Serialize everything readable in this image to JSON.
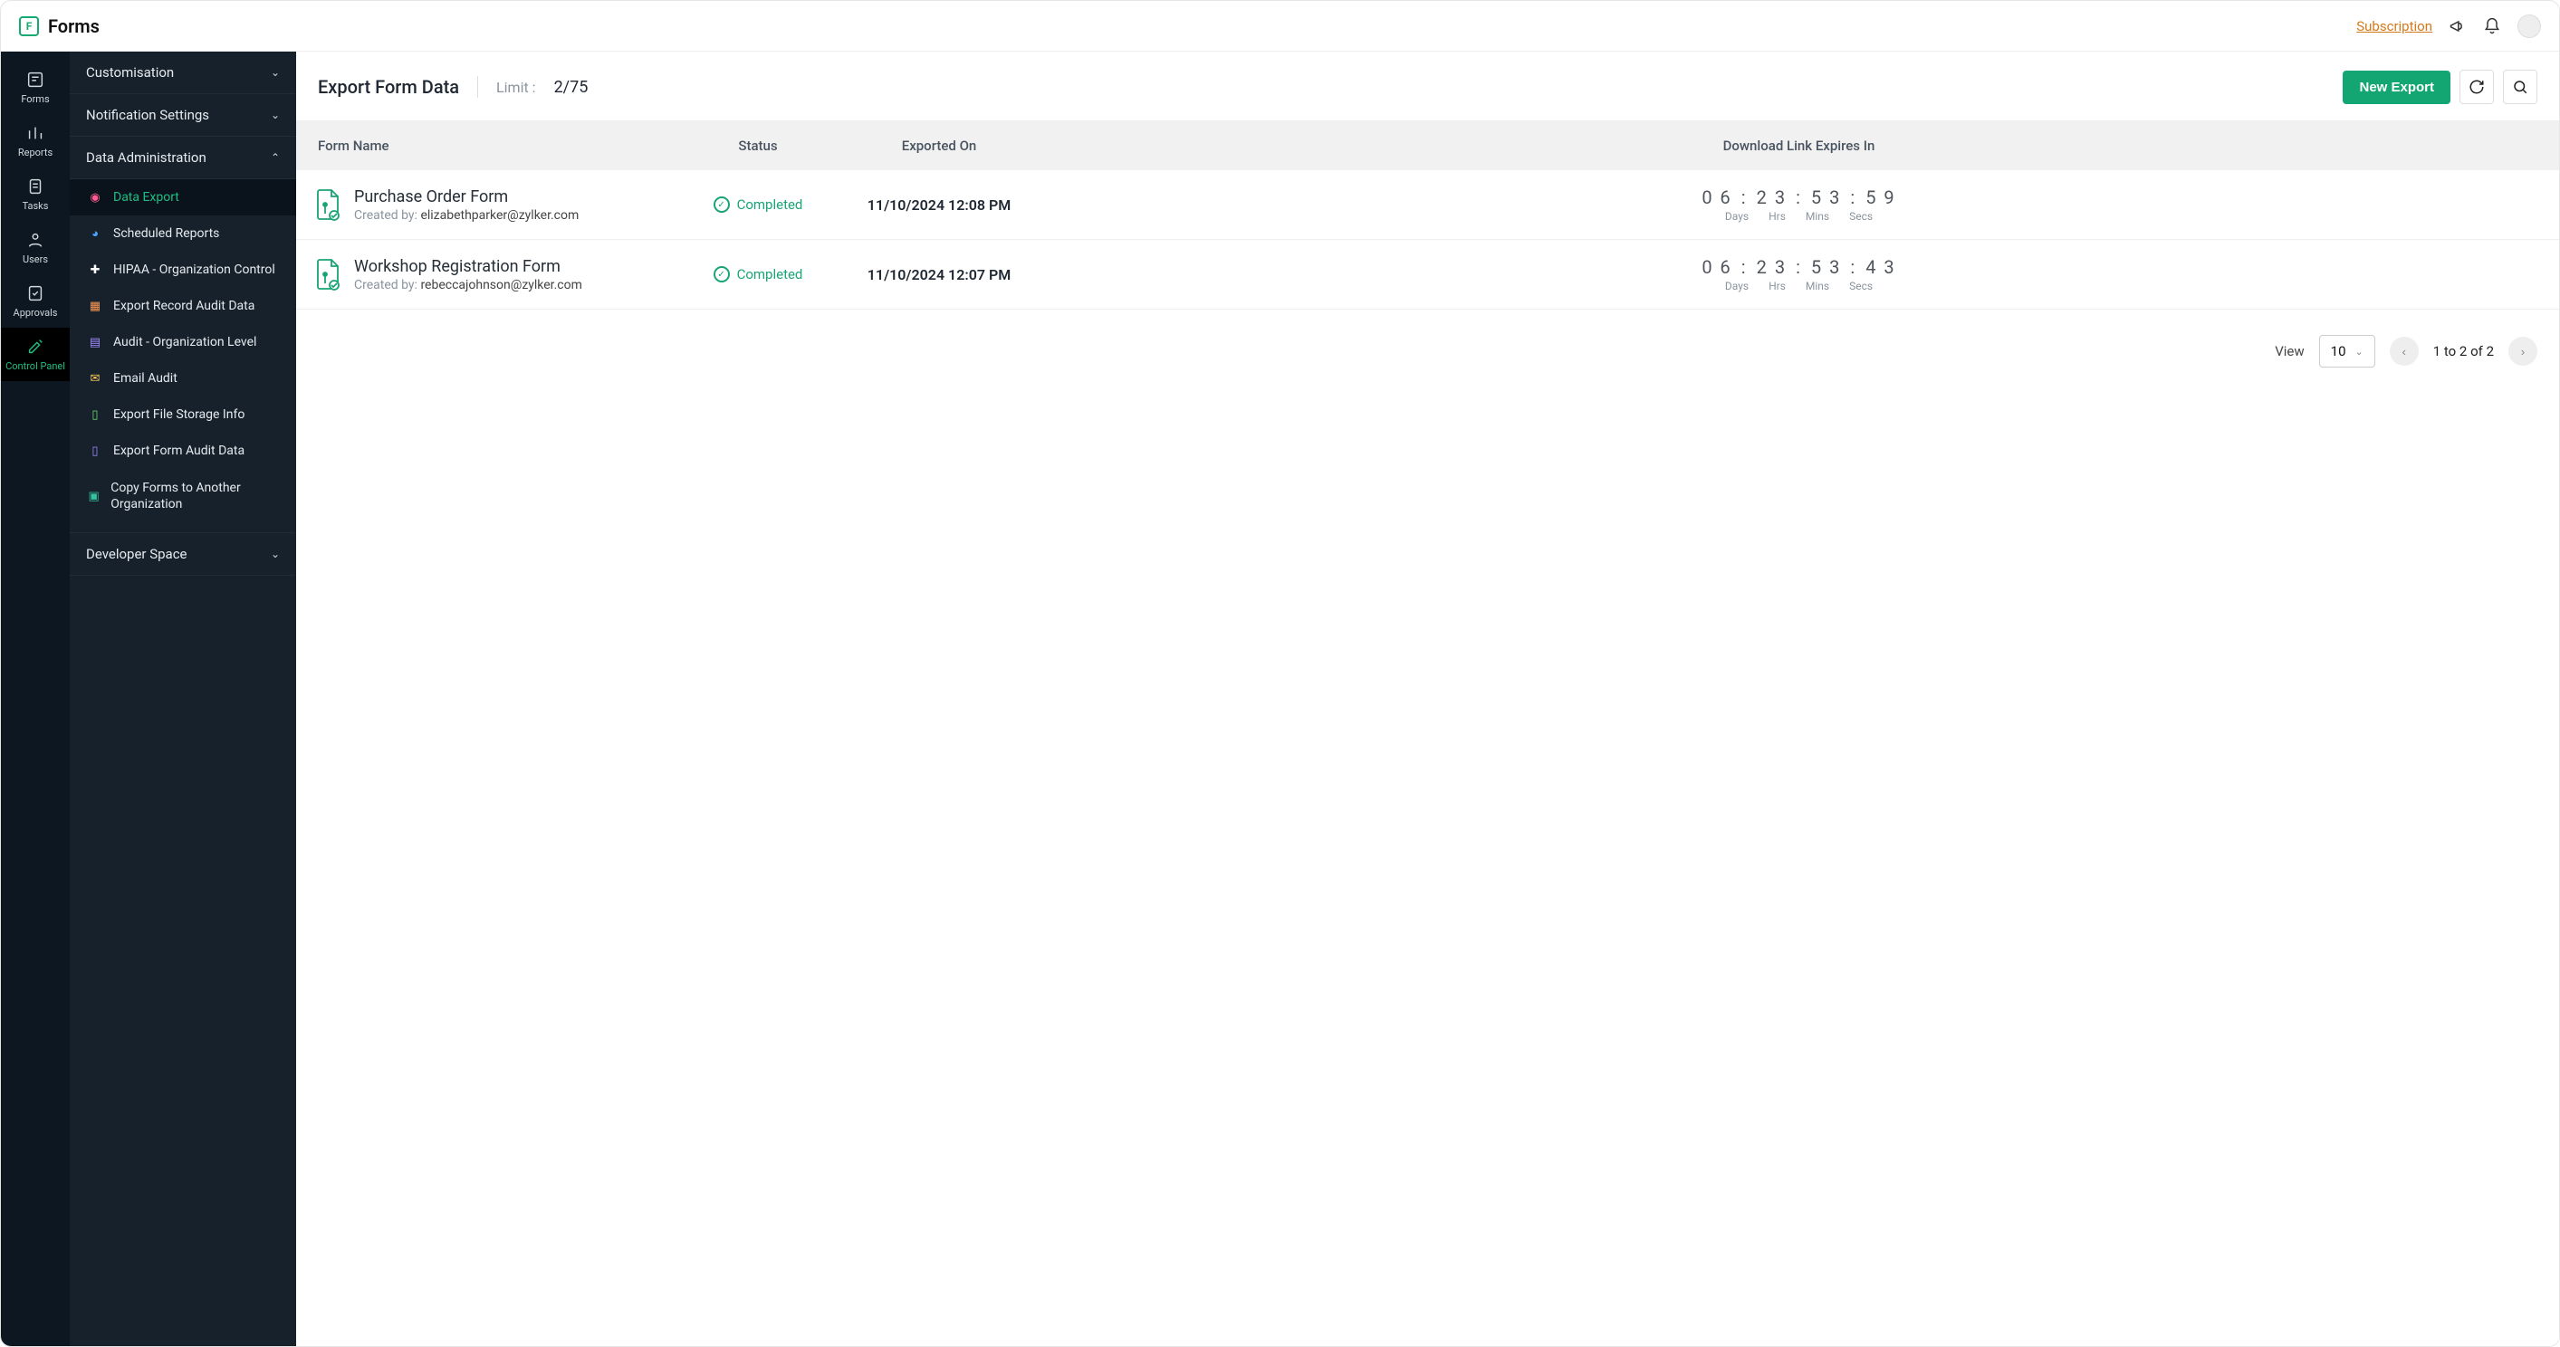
{
  "header": {
    "appTitle": "Forms",
    "subscription": "Subscription"
  },
  "rail": {
    "items": [
      {
        "label": "Forms",
        "icon": "▭"
      },
      {
        "label": "Reports",
        "icon": "▯"
      },
      {
        "label": "Tasks",
        "icon": "▤"
      },
      {
        "label": "Users",
        "icon": "◉"
      },
      {
        "label": "Approvals",
        "icon": "▭"
      },
      {
        "label": "Control Panel",
        "icon": "✕"
      }
    ]
  },
  "sidebar": {
    "groups": [
      {
        "label": "Customisation",
        "expanded": false
      },
      {
        "label": "Notification Settings",
        "expanded": false
      },
      {
        "label": "Data Administration",
        "expanded": true
      },
      {
        "label": "Developer Space",
        "expanded": false
      }
    ],
    "data_admin_items": [
      {
        "label": "Data Export"
      },
      {
        "label": "Scheduled Reports"
      },
      {
        "label": "HIPAA - Organization Control"
      },
      {
        "label": "Export Record Audit Data"
      },
      {
        "label": "Audit - Organization Level"
      },
      {
        "label": "Email Audit"
      },
      {
        "label": "Export File Storage Info"
      },
      {
        "label": "Export Form Audit Data"
      },
      {
        "label": "Copy Forms to Another Organization"
      }
    ]
  },
  "page": {
    "title": "Export Form Data",
    "limitLabel": "Limit :",
    "limitValue": "2/75",
    "newExport": "New Export"
  },
  "table": {
    "columns": {
      "name": "Form Name",
      "status": "Status",
      "exported": "Exported On",
      "expires": "Download Link Expires In"
    },
    "createdByLabel": "Created by:",
    "statusText": "Completed",
    "countdownLabels": {
      "days": "Days",
      "hrs": "Hrs",
      "mins": "Mins",
      "secs": "Secs"
    },
    "rows": [
      {
        "formName": "Purchase Order Form",
        "createdBy": "elizabethparker@zylker.com",
        "exportedOn": "11/10/2024 12:08 PM",
        "countdown": {
          "days": "0 6",
          "hrs": "2 3",
          "mins": "5 3",
          "secs": "5 9"
        }
      },
      {
        "formName": "Workshop Registration Form",
        "createdBy": "rebeccajohnson@zylker.com",
        "exportedOn": "11/10/2024 12:07 PM",
        "countdown": {
          "days": "0 6",
          "hrs": "2 3",
          "mins": "5 3",
          "secs": "4 3"
        }
      }
    ]
  },
  "pagination": {
    "viewLabel": "View",
    "pageSize": "10",
    "range": "1 to 2 of 2"
  }
}
